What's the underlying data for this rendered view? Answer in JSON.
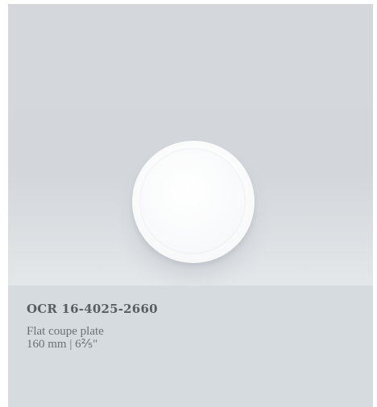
{
  "product": {
    "code": "OCR 16-4025-2660",
    "name": "Flat coupe plate",
    "size": "160 mm | 6⅖\""
  },
  "colors": {
    "card_background": "#d6dbdf",
    "text": "#6b7075",
    "code_text": "#585d62",
    "plate": "#ffffff"
  }
}
